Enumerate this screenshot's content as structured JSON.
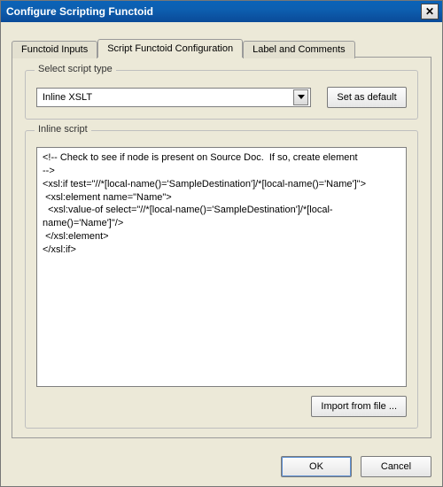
{
  "window": {
    "title": "Configure Scripting Functoid"
  },
  "tabs": {
    "inputs": "Functoid Inputs",
    "config": "Script Functoid Configuration",
    "label": "Label and Comments"
  },
  "script_type_group": {
    "legend": "Select script type",
    "selected": "Inline XSLT",
    "set_default": "Set as default"
  },
  "inline_script_group": {
    "legend": "Inline script",
    "content": "<!-- Check to see if node is present on Source Doc.  If so, create element\n-->\n<xsl:if test=\"//*[local-name()='SampleDestination']/*[local-name()='Name']\">\n <xsl:element name=\"Name\">\n  <xsl:value-of select=\"//*[local-name()='SampleDestination']/*[local-name()='Name']\"/>\n </xsl:element>\n</xsl:if>",
    "import": "Import from file ..."
  },
  "footer": {
    "ok": "OK",
    "cancel": "Cancel"
  }
}
